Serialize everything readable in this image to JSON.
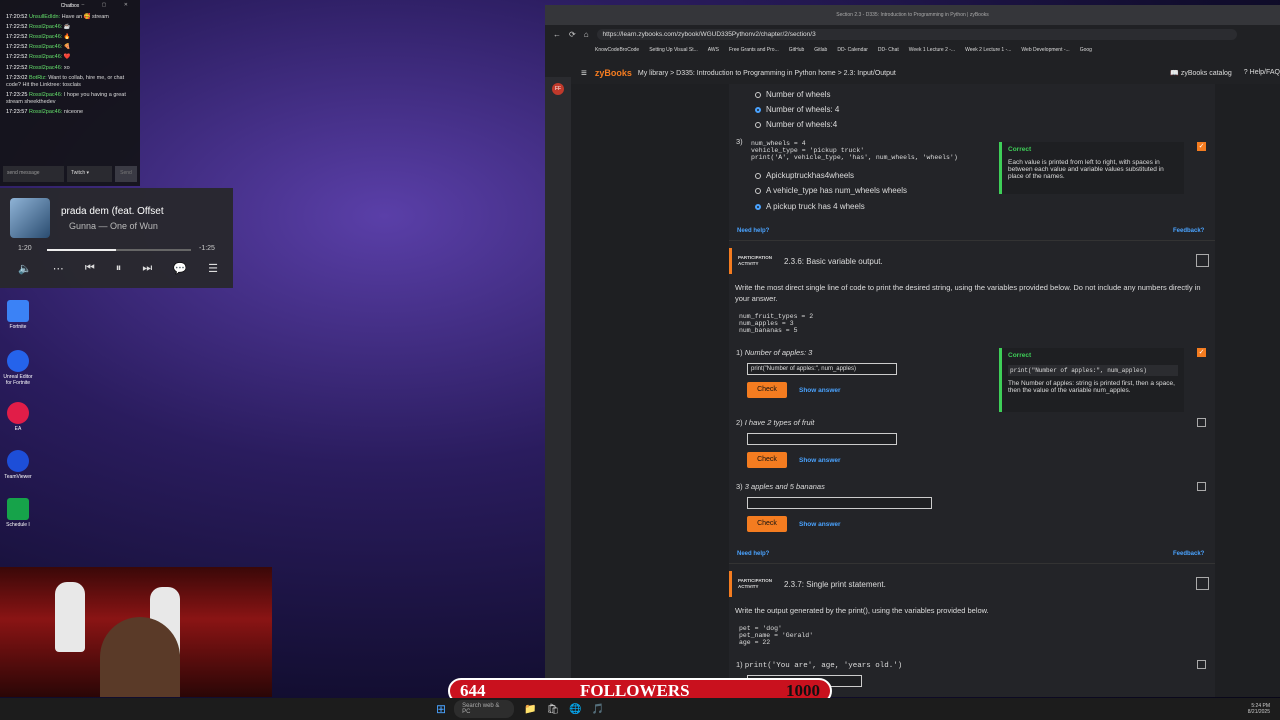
{
  "chatbox": {
    "title": "Chatbox",
    "messages": [
      {
        "ts": "17:20:52",
        "user": "UnsullEdIdn:",
        "text": "Have an 🥰 stream"
      },
      {
        "ts": "17:22:52",
        "user": "Rossl2pac46:",
        "text": "☕"
      },
      {
        "ts": "17:22:52",
        "user": "Rossl2pac46:",
        "text": "🔥"
      },
      {
        "ts": "17:22:52",
        "user": "Rossl2pac46:",
        "text": "🍕"
      },
      {
        "ts": "17:22:52",
        "user": "Rossl2pac46:",
        "text": "❤️"
      },
      {
        "ts": "17:22:52",
        "user": "Rossl2pac46:",
        "text": "xo"
      },
      {
        "ts": "17:23:02",
        "user": "BotRiz:",
        "text": "Want to collab, hire me, or chat code? Hit the Linktree: tosclais"
      },
      {
        "ts": "17:23:25",
        "user": "Rossl2pac46:",
        "text": "I hope you having a great stream sheekthedev"
      },
      {
        "ts": "17:23:57",
        "user": "Rossl2pac46:",
        "text": "niceone"
      }
    ],
    "input_placeholder": "send message",
    "platform": "Twitch",
    "send_label": "Send"
  },
  "player": {
    "title": "prada dem (feat. Offset",
    "artist": "Gunna — One of Wun",
    "elapsed": "1:20",
    "remaining": "-1:25",
    "progress": 0.48
  },
  "desktop_icons": [
    "Fortnite",
    "Unreal Editor for Fortnite",
    "EA",
    "TeamViewer",
    "Schedule I"
  ],
  "browser": {
    "tab_title": "Section 2.3 - D335: Introduction to Programming in Python | zyBooks",
    "url": "https://learn.zybooks.com/zybook/WGUD335Pythonv2/chapter/2/section/3",
    "bookmarks": [
      "KnowCodeBroCode",
      "Setting Up Visual St...",
      "AWS",
      "Free Grants and Pro...",
      "GitHub",
      "Gitlab",
      "DD- Calendar",
      "DD- Chat",
      "Week 1 Lecture 2 -...",
      "Week 2 Lecture 1 -...",
      "Web Development -...",
      "Goog"
    ],
    "avatar_initials": "FF"
  },
  "zy": {
    "logo": "zyBooks",
    "breadcrumb": "My library > D335: Introduction to Programming in Python home > 2.3: Input/Output",
    "catalog": "zyBooks catalog",
    "help": "Help/FAQ"
  },
  "q_prev": {
    "options_top": [
      "Number of wheels",
      "Number of wheels: 4",
      "Number of wheels:4"
    ],
    "num": "3)",
    "code": "num_wheels = 4\nvehicle_type = 'pickup truck'\nprint('A', vehicle_type, 'has', num_wheels, 'wheels')",
    "options": [
      "Apickuptruckhas4wheels",
      "A vehicle_type has num_wheels wheels",
      "A pickup truck has 4 wheels"
    ],
    "fb_head": "Correct",
    "fb_text": "Each value is printed from left to right, with spaces in between each value and variable values substituted in place of the names.",
    "need_help": "Need help?",
    "feedback": "Feedback?"
  },
  "act236": {
    "label": "PARTICIPATION ACTIVITY",
    "title": "2.3.6: Basic variable output.",
    "instructions": "Write the most direct single line of code to print the desired string, using the variables provided below. Do not include any numbers directly in your answer.",
    "code": "num_fruit_types = 2\nnum_apples = 3\nnum_bananas = 5",
    "q1_num": "1)",
    "q1": "Number of apples: 3",
    "q1_value": "print(\"Number of apples:\", num_apples)",
    "q2_num": "2)",
    "q2": "I have 2 types of fruit",
    "q3_num": "3)",
    "q3": "3 apples and 5 bananas",
    "check": "Check",
    "show": "Show answer",
    "fb_head": "Correct",
    "fb_code": "print(\"Number of apples:\", num_apples)",
    "fb_text": "The Number of apples: string is printed first, then a space, then the value of the variable num_apples.",
    "need_help": "Need help?",
    "feedback": "Feedback?"
  },
  "act237": {
    "label": "PARTICIPATION ACTIVITY",
    "title": "2.3.7: Single print statement.",
    "instructions": "Write the output generated by the print(), using the variables provided below.",
    "code": "pet = 'dog'\npet_name = 'Gerald'\nage = 22",
    "q1_num": "1)",
    "q1": "print('You are', age, 'years old.')"
  },
  "followers": {
    "current": "644",
    "label": "FOLLOWERS",
    "goal": "1000"
  },
  "taskbar": {
    "search": "Search web & PC",
    "time": "5:24 PM",
    "date": "8/21/2025"
  }
}
